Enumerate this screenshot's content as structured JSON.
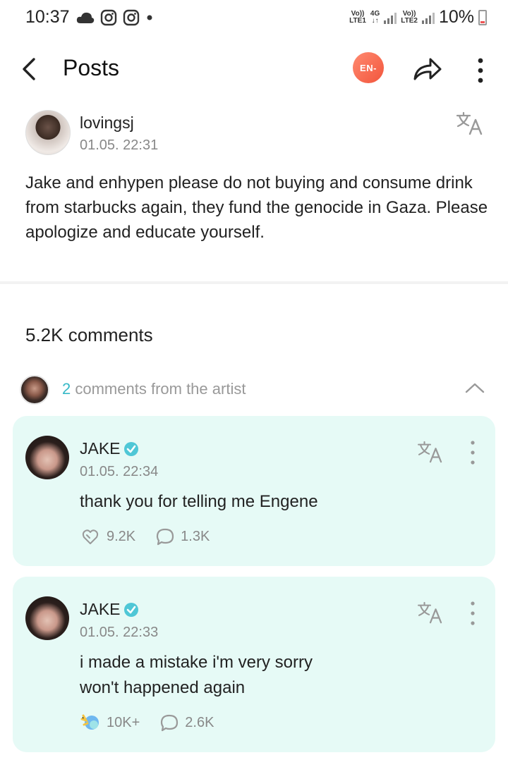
{
  "status_bar": {
    "time": "10:37",
    "network_1": {
      "top": "Vo))",
      "mid": "4G",
      "bottom": "LTE1"
    },
    "network_2": {
      "top": "Vo))",
      "bottom": "LTE2"
    },
    "battery": "10%"
  },
  "header": {
    "title": "Posts",
    "badge": "EN-"
  },
  "post": {
    "username": "lovingsj",
    "date": "01.05. 22:31",
    "text": "Jake and enhypen please do not buying and consume drink from starbucks again, they fund the genocide in Gaza. Please apologize and educate yourself."
  },
  "comments_count": "5.2K comments",
  "artist_comments": {
    "count": "2",
    "label": "comments from the artist"
  },
  "comments": [
    {
      "name": "JAKE",
      "date": "01.05. 22:34",
      "text": "thank you for telling me Engene",
      "likes": "9.2K",
      "replies": "1.3K"
    },
    {
      "name": "JAKE",
      "date": "01.05. 22:33",
      "text_line1": "i made a mistake i'm very sorry",
      "text_line2": "won't happened again",
      "likes": "10K+",
      "replies": "2.6K"
    }
  ],
  "colors": {
    "accent": "#36b9c7",
    "card_bg": "#e6faf6",
    "badge": "#f2553c"
  }
}
